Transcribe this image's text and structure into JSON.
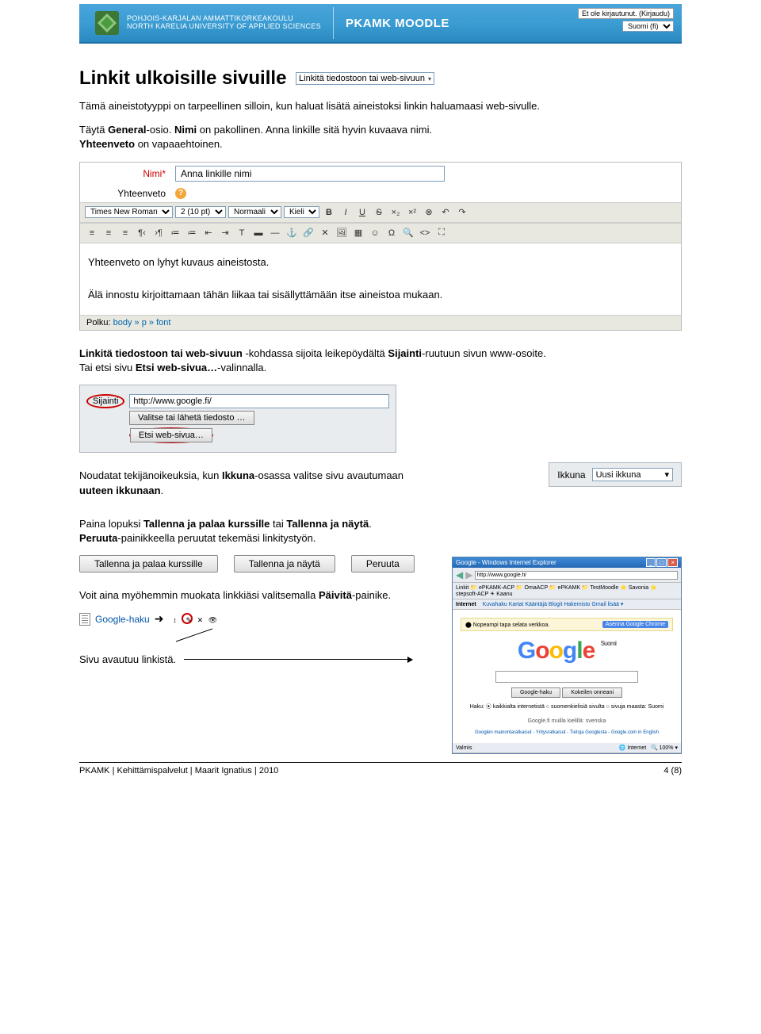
{
  "header": {
    "uni_fi": "POHJOIS-KARJALAN AMMATTIKORKEAKOULU",
    "uni_en": "NORTH KARELIA UNIVERSITY OF APPLIED SCIENCES",
    "title": "PKAMK MOODLE",
    "login_text": "Et ole kirjautunut. (Kirjaudu)",
    "lang": "Suomi (fi)"
  },
  "title": "Linkit ulkoisille sivuille",
  "dropdown_top": "Linkitä tiedostoon tai web-sivuun",
  "para1": {
    "t1": "Tämä aineistotyyppi on tarpeellinen silloin, kun haluat lisätä aineistoksi linkin haluamaasi web-sivulle.",
    "t2a": "Täytä ",
    "t2b": "General",
    "t2c": "-osio. ",
    "t2d": "Nimi",
    "t2e": " on pakollinen. Anna linkille sitä hyvin kuvaava nimi.",
    "t3a": "Yhteenveto",
    "t3b": " on vapaaehtoinen."
  },
  "editor": {
    "name_label": "Nimi",
    "name_value": "Anna linkille nimi",
    "summary_label": "Yhteenveto",
    "font": "Times New Roman",
    "size": "2 (10 pt)",
    "style": "Normaali",
    "lang": "Kieli",
    "body1": "Yhteenveto on lyhyt kuvaus aineistosta.",
    "body2": "Älä innostu kirjoittamaan tähän liikaa tai sisällyttämään itse aineistoa mukaan.",
    "path_label": "Polku:",
    "path_value": "body » p » font"
  },
  "para2": {
    "a": "Linkitä tiedostoon tai web-sivuun",
    "b": " -kohdassa sijoita leikepöydältä ",
    "c": "Sijainti",
    "d": "-ruutuun sivun www-osoite.",
    "e": "Tai etsi sivu ",
    "f": "Etsi web-sivua…",
    "g": "-valinnalla."
  },
  "sijainti": {
    "label": "Sijainti",
    "url": "http://www.google.fi/",
    "btn1": "Valitse tai lähetä tiedosto …",
    "btn2": "Etsi web-sivua…"
  },
  "para3": {
    "a": "Noudatat tekijänoikeuksia, kun ",
    "b": "Ikkuna",
    "c": "-osassa valitse sivu avautumaan ",
    "d": "uuteen ikkunaan",
    "e": "."
  },
  "ikkuna": {
    "label": "Ikkuna",
    "value": "Uusi ikkuna"
  },
  "para4": {
    "a": "Paina lopuksi ",
    "b": "Tallenna ja palaa kurssille",
    "c": " tai ",
    "d": "Tallenna ja näytä",
    "e": ".",
    "f": "Peruuta",
    "g": "-painikkeella peruutat tekemäsi linkitystyön."
  },
  "buttons": {
    "save_return": "Tallenna ja palaa kurssille",
    "save_show": "Tallenna ja näytä",
    "cancel": "Peruuta"
  },
  "para5": {
    "a": "Voit aina myöhemmin muokata linkkiäsi valitsemalla ",
    "b": "Päivitä",
    "c": "-painike."
  },
  "google_link": "Google-haku",
  "para6": "Sivu avautuu linkistä.",
  "ie": {
    "title": "Google - Windows Internet Explorer",
    "navlinks": "Kuvahaku  Kartat  Kääntäjä  Blogit  Hakemisto  Gmail  lisää ▾",
    "tab": "Internet",
    "chrome_text": "Nopeampi tapa selata verkkoa.",
    "chrome_btn": "Asenna Google Chrome",
    "suomi": "Suomi",
    "btn1": "Google-haku",
    "btn2": "Kokeilen onneani",
    "radio": "Haku: ⦿ kaikkialta internetistä  ○ suomenkielisiä sivulta  ○ sivuja maasta: Suomi",
    "other_lang": "Google.fi muilla kielillä: svenska",
    "footer": "Googlen mainontaratkaisut - Yritysratkaisut - Tietoja Googlesta - Google.com in English"
  },
  "footer": {
    "left": "PKAMK | Kehittämispalvelut | Maarit Ignatius | 2010",
    "right": "4 (8)"
  }
}
